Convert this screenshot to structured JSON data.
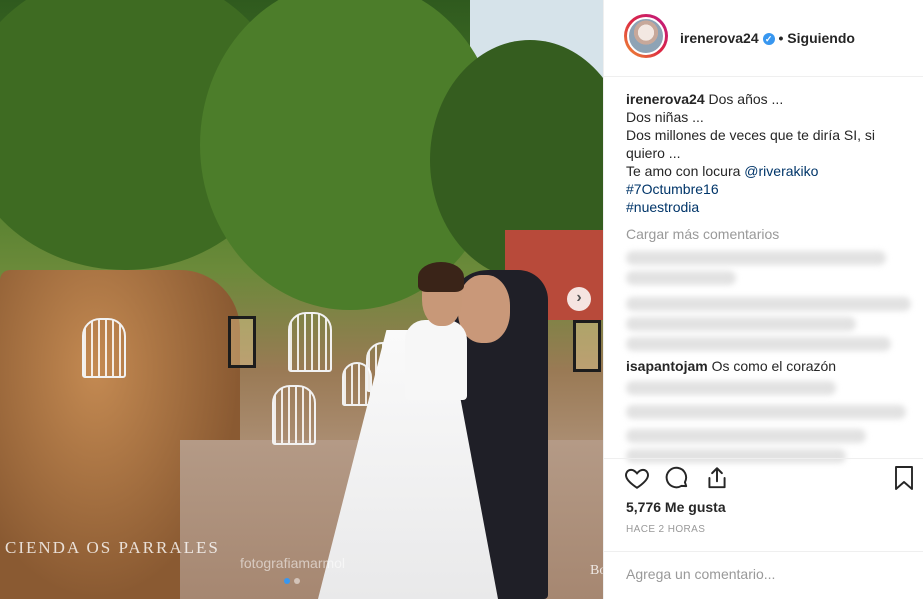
{
  "post": {
    "username": "irenerova24",
    "follow_status": "Siguiendo",
    "separator": "•",
    "verified_symbol": "✓",
    "caption": {
      "user": "irenerova24",
      "lines": [
        "Dos años ...",
        "Dos niñas ...",
        "Dos millones de veces que te diría SI, si quiero ...",
        "Te amo con locura"
      ],
      "mention": "@riverakiko",
      "hashtags": [
        "#7Octumbre16",
        "#nuestrodia"
      ]
    },
    "load_more": "Cargar más comentarios",
    "visible_comment": {
      "user": "isapantojam",
      "text": "Os como el corazón"
    },
    "likes": "5,776 Me gusta",
    "time": "HACE 2 HORAS",
    "comment_placeholder": "Agrega un comentario..."
  },
  "photo": {
    "watermark_left": "CIENDA  OS PARRALES",
    "watermark_center": "fotografiamarmol",
    "watermark_right": "Bo",
    "next_symbol": "›",
    "accent": "#3897f0"
  },
  "icons": [
    "heart-icon",
    "comment-icon",
    "share-icon",
    "bookmark-icon",
    "chevron-right-icon",
    "verified-icon"
  ]
}
